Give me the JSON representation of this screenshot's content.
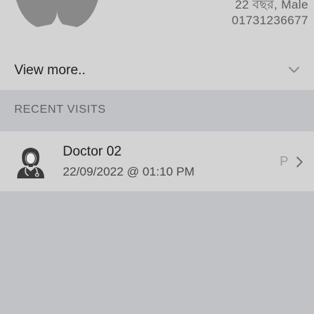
{
  "profile": {
    "age_gender": "22 বছর, Male",
    "phone": "01731236677",
    "view_more_label": "View more.."
  },
  "recent_visits": {
    "section_title": "RECENT VISITS",
    "items": [
      {
        "doctor_name": "Doctor 02",
        "datetime": "22/09/2022 @ 01:10 PM",
        "status": "P"
      }
    ]
  },
  "colors": {
    "screen_bg": "#c1c2c6",
    "card_bg": "#d3d3d3",
    "avatar_gray": "#888888"
  },
  "icons": [
    "avatar-placeholder-icon",
    "chevron-down-icon",
    "female-doctor-icon",
    "chevron-right-icon"
  ]
}
